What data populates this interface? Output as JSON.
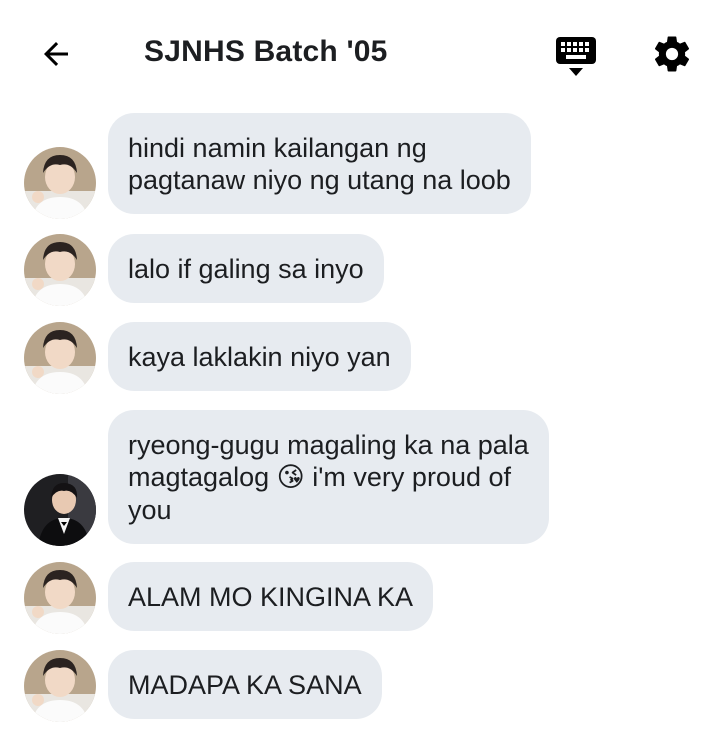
{
  "header": {
    "title": "SJNHS Batch '05",
    "back_icon": "arrow-left-icon",
    "keyboard_icon": "keyboard-icon",
    "settings_icon": "gear-icon"
  },
  "colors": {
    "bubble": "#e7ebf0",
    "text": "#1c1e21",
    "icon": "#000000"
  },
  "messages": [
    {
      "text": "hindi namin kailangan ng\npagtanaw niyo ng utang na loob",
      "avatar": "avatar-a"
    },
    {
      "text": "lalo if galing sa inyo",
      "avatar": "avatar-a"
    },
    {
      "text": "kaya laklakin niyo yan",
      "avatar": "avatar-a"
    },
    {
      "text_before": "ryeong-gugu magaling ka na pala\nmagtagalog ",
      "emoji": "😘",
      "text_after": " i'm very proud of\nyou",
      "avatar": "avatar-b"
    },
    {
      "text": "ALAM MO KINGINA KA",
      "avatar": "avatar-a"
    },
    {
      "text": "MADAPA KA SANA",
      "avatar": "avatar-a"
    }
  ]
}
